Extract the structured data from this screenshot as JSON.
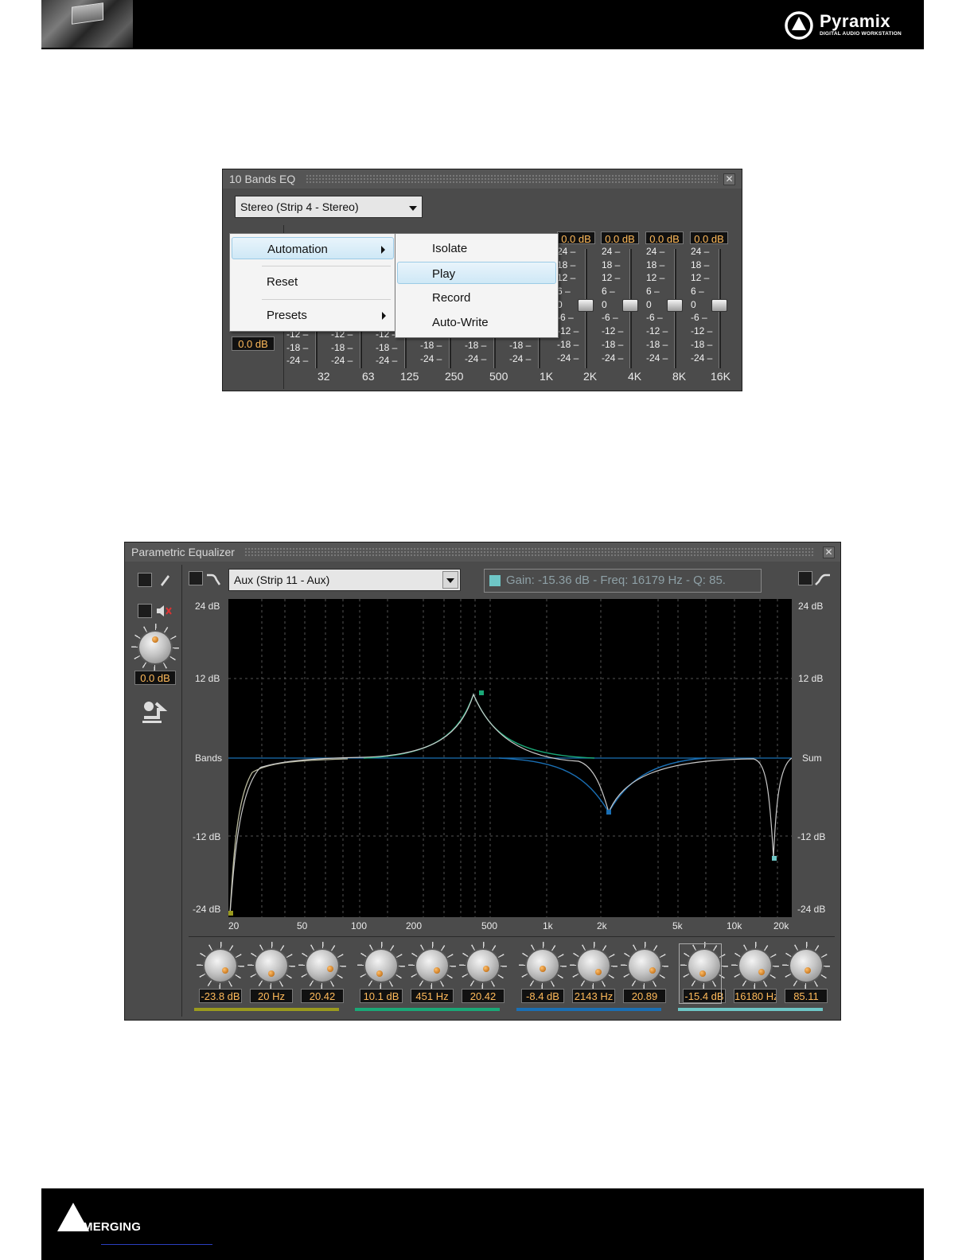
{
  "header": {
    "brand_name": "Pyramix",
    "brand_tagline": "DIGITAL AUDIO WORKSTATION"
  },
  "footer": {
    "brand_name": "MERGING"
  },
  "graphic_eq": {
    "title": "10 Bands EQ",
    "close_glyph": "✕",
    "channel_select": "Stereo (Strip 4 - Stereo)",
    "master_value": "0.0 dB",
    "band_values": [
      "0.0 dB",
      "0.0 dB",
      "0.0 dB",
      "0.0 dB"
    ],
    "scale_top": [
      "24 –",
      "18 –",
      "12 –",
      "6 –",
      "0",
      "-6 –",
      "-12 –",
      "-18 –",
      "-24 –"
    ],
    "scale_partial": [
      "-12 –",
      "-18 –",
      "-24 –"
    ],
    "freq_labels": [
      "32",
      "63",
      "125",
      "250",
      "500",
      "1K",
      "2K",
      "4K",
      "8K",
      "16K"
    ],
    "context_menu": {
      "items": [
        "Automation",
        "Reset",
        "Presets"
      ],
      "submenu": [
        "Isolate",
        "Play",
        "Record",
        "Auto-Write"
      ]
    }
  },
  "param_eq": {
    "title": "Parametric Equalizer",
    "close_glyph": "✕",
    "channel_select": "Aux (Strip 11 - Aux)",
    "status_text": "Gain: -15.36 dB -  Freq: 16179 Hz -  Q: 85.",
    "output_gain": "0.0 dB",
    "y_labels_left": [
      "24 dB",
      "12 dB",
      "Bands",
      "-12 dB",
      "-24 dB"
    ],
    "y_labels_right": [
      "24 dB",
      "12 dB",
      "Sum",
      "-12 dB",
      "-24 dB"
    ],
    "x_labels": [
      "20",
      "50",
      "100",
      "200",
      "500",
      "1k",
      "2k",
      "5k",
      "10k",
      "20k"
    ],
    "bands": [
      {
        "color": "#9a9a1e",
        "values": [
          "-23.8 dB",
          "20 Hz",
          "20.42"
        ]
      },
      {
        "color": "#1aa877",
        "values": [
          "10.1 dB",
          "451 Hz",
          "20.42"
        ]
      },
      {
        "color": "#1a6fb4",
        "values": [
          "-8.4 dB",
          "2143 Hz",
          "20.89"
        ]
      },
      {
        "color": "#6ec6c6",
        "values": [
          "-15.4 dB",
          "16180 Hz",
          "85.11"
        ]
      }
    ],
    "icons": [
      "bypass-toggle-icon",
      "lowcut-icon",
      "highshelf-icon",
      "mute-speaker-icon",
      "reset-arrow-icon",
      "knob-icon"
    ]
  }
}
